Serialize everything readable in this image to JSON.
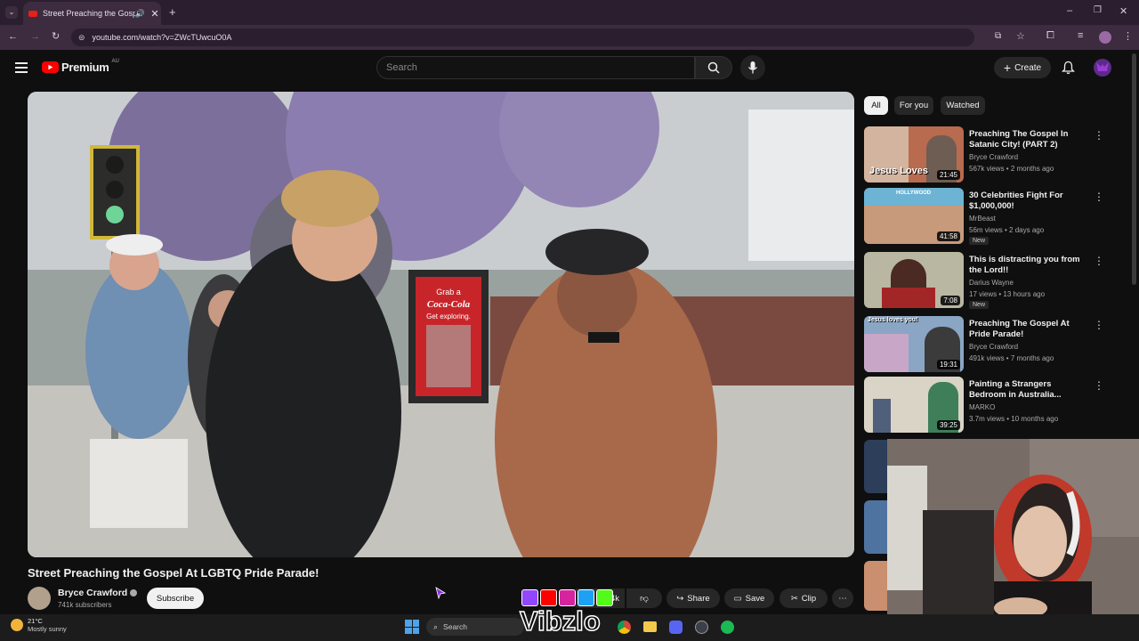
{
  "browser": {
    "tab_title": "Street Preaching the Gospel At LGBTQ Pride Parade!",
    "url": "youtube.com/watch?v=ZWcTUwcuO0A"
  },
  "youtube": {
    "brand": "Premium",
    "region": "AU",
    "search_placeholder": "Search",
    "create_label": "Create"
  },
  "video": {
    "title": "Street Preaching the Gospel At LGBTQ Pride Parade!",
    "channel": "Bryce Crawford",
    "subscribers": "741k subscribers",
    "subscribe_label": "Subscribe",
    "likes": "4k",
    "share_label": "Share",
    "save_label": "Save",
    "clip_label": "Clip",
    "sign_top": "Grab a",
    "sign_brand": "Coca-Cola",
    "sign_bottom": "Get exploring."
  },
  "chips": [
    "All",
    "For you",
    "Watched"
  ],
  "recommendations": [
    {
      "title": "Preaching The Gospel In Satanic City! (PART 2)",
      "channel": "Bryce Crawford",
      "views": "567k views • 2 months ago",
      "duration": "21:45",
      "new": "",
      "thumb_text": "Jesus Loves"
    },
    {
      "title": "30 Celebrities Fight For $1,000,000!",
      "channel": "MrBeast",
      "views": "56m views • 2 days ago",
      "duration": "41:58",
      "new": "New",
      "thumb_text": "HOLLYWOOD"
    },
    {
      "title": "This is distracting you from the Lord!!",
      "channel": "Darius Wayne",
      "views": "17 views • 13 hours ago",
      "duration": "7:08",
      "new": "New",
      "thumb_text": ""
    },
    {
      "title": "Preaching The Gospel At Pride Parade!",
      "channel": "Bryce Crawford",
      "views": "491k views • 7 months ago",
      "duration": "19:31",
      "new": "",
      "thumb_text": "Jesus loves you!"
    },
    {
      "title": "Painting a Strangers Bedroom in Australia...",
      "channel": "MARKO",
      "views": "3.7m views • 10 months ago",
      "duration": "39:25",
      "new": "",
      "thumb_text": ""
    }
  ],
  "taskbar": {
    "temperature": "21°C",
    "weather": "Mostly sunny",
    "search_label": "Search"
  },
  "overlay": {
    "watermark": "Vibzlo"
  },
  "colors": {
    "youtube_red": "#ff0000",
    "browser_frame": "#2b1f2f"
  }
}
